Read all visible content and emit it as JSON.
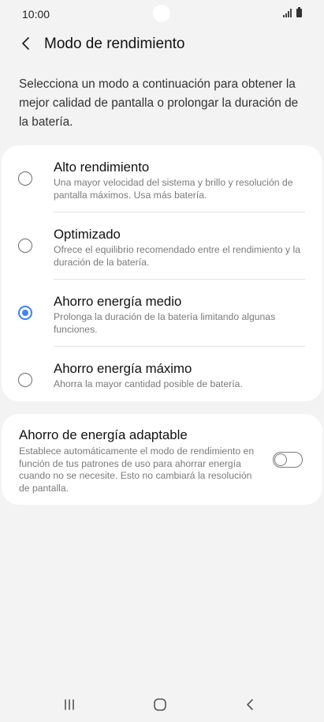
{
  "status_bar": {
    "time": "10:00"
  },
  "header": {
    "title": "Modo de rendimiento",
    "back_icon": "chevron-left-icon"
  },
  "description": "Selecciona un modo a continuación para obtener la mejor calidad de pantalla o prolongar la duración de la batería.",
  "modes": [
    {
      "title": "Alto rendimiento",
      "description": "Una mayor velocidad del sistema y brillo y resolución de pantalla máximos. Usa más batería.",
      "selected": false
    },
    {
      "title": "Optimizado",
      "description": "Ofrece el equilibrio recomendado entre el rendimiento y la duración de la batería.",
      "selected": false
    },
    {
      "title": "Ahorro energía medio",
      "description": "Prolonga la duración de la batería limitando algunas funciones.",
      "selected": true
    },
    {
      "title": "Ahorro energía máximo",
      "description": "Ahorra la mayor cantidad posible de batería.",
      "selected": false
    }
  ],
  "adaptive": {
    "title": "Ahorro de energía adaptable",
    "description": "Establece automáticamente el modo de rendimiento en función de tus patrones de uso para ahorrar energía cuando no se necesite. Esto no cambiará la resolución de pantalla.",
    "enabled": false
  },
  "colors": {
    "accent": "#3e82f7",
    "background": "#f3f3f3",
    "card": "#ffffff"
  },
  "nav_bar": {
    "recents_icon": "recents-icon",
    "home_icon": "home-icon",
    "back_icon": "back-icon"
  }
}
